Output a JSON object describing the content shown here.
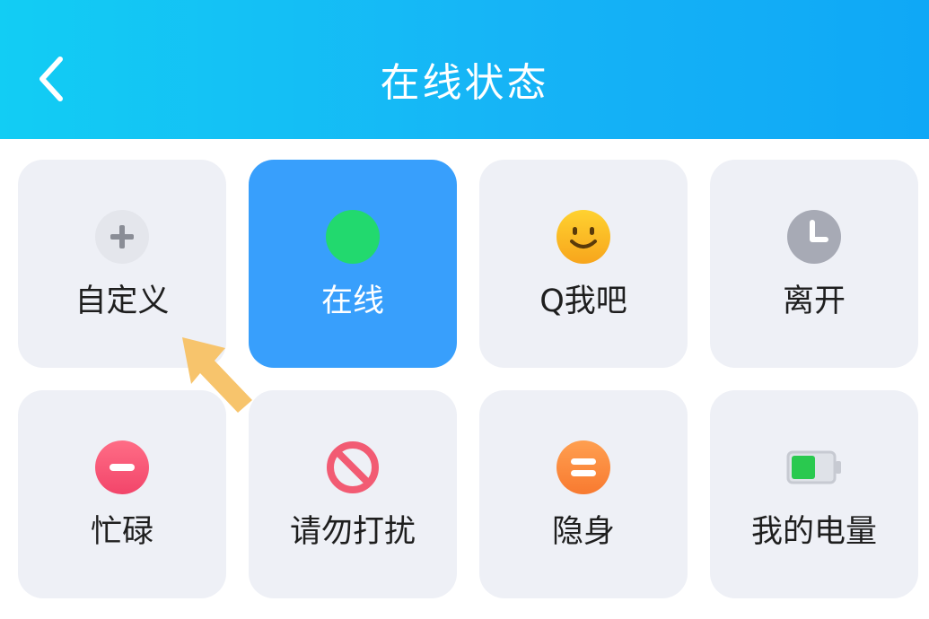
{
  "header": {
    "title": "在线状态",
    "back_icon": "chevron-left-icon"
  },
  "status_options": [
    {
      "label": "自定义",
      "icon": "plus-icon",
      "selected": false
    },
    {
      "label": "在线",
      "icon": "green-dot-icon",
      "selected": true
    },
    {
      "label": "Q我吧",
      "icon": "smiley-icon",
      "selected": false
    },
    {
      "label": "离开",
      "icon": "clock-icon",
      "selected": false
    },
    {
      "label": "忙碌",
      "icon": "minus-circle-icon",
      "selected": false
    },
    {
      "label": "请勿打扰",
      "icon": "no-entry-icon",
      "selected": false
    },
    {
      "label": "隐身",
      "icon": "equals-circle-icon",
      "selected": false
    },
    {
      "label": "我的电量",
      "icon": "battery-icon",
      "selected": false
    }
  ],
  "colors": {
    "header_gradient_start": "#12cdf4",
    "header_gradient_end": "#0fa8f6",
    "selected_card": "#389ffc",
    "card_background": "#eef0f6",
    "pointer_arrow": "#f7c46c"
  },
  "annotation": {
    "icon": "pointer-arrow-icon"
  }
}
